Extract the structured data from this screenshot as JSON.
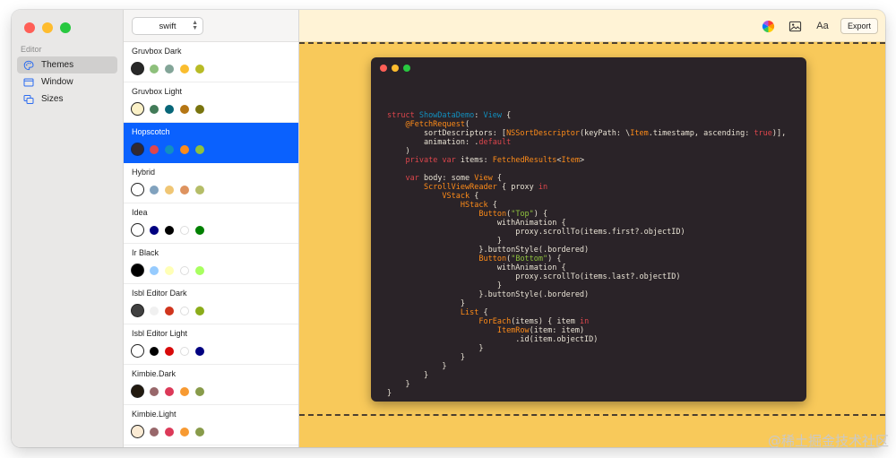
{
  "sidebar": {
    "header": "Editor",
    "items": [
      {
        "label": "Themes",
        "icon": "palette-icon",
        "active": true
      },
      {
        "label": "Window",
        "icon": "window-icon",
        "active": false
      },
      {
        "label": "Sizes",
        "icon": "sizes-icon",
        "active": false
      }
    ]
  },
  "language_select": {
    "value": "swift"
  },
  "themes": [
    {
      "name": "Gruvbox Dark",
      "background": "#282828",
      "colors": [
        "#8ec07c",
        "#83a598",
        "#fabd2f",
        "#b8bb26"
      ],
      "selected": false
    },
    {
      "name": "Gruvbox Light",
      "background": "#fbf1c7",
      "colors": [
        "#427b58",
        "#076678",
        "#b57614",
        "#79740e"
      ],
      "selected": false
    },
    {
      "name": "Hopscotch",
      "background": "#322931",
      "colors": [
        "#dd464c",
        "#1290bf",
        "#fd8b19",
        "#8fc13e"
      ],
      "selected": true
    },
    {
      "name": "Hybrid",
      "background": "#ffffff",
      "colors": [
        "#81a2be",
        "#f0c674",
        "#de935f",
        "#b5bd68"
      ],
      "selected": false
    },
    {
      "name": "Idea",
      "background": "#ffffff",
      "colors": [
        "#000080",
        "#000000",
        "#ffffff",
        "#008000"
      ],
      "selected": false
    },
    {
      "name": "Ir Black",
      "background": "#000000",
      "colors": [
        "#96cbfe",
        "#ffffb6",
        "#ffffff",
        "#a8ff60"
      ],
      "selected": false
    },
    {
      "name": "Isbl Editor Dark",
      "background": "#404040",
      "colors": [
        "#f0f0f0",
        "#d0351d",
        "#ffffff",
        "#8bac1a"
      ],
      "selected": false
    },
    {
      "name": "Isbl Editor Light",
      "background": "#ffffff",
      "colors": [
        "#000000",
        "#d80a0a",
        "#ffffff",
        "#000080"
      ],
      "selected": false
    },
    {
      "name": "Kimbie.Dark",
      "background": "#221a0f",
      "colors": [
        "#98676a",
        "#dc3958",
        "#f79a32",
        "#889b4a"
      ],
      "selected": false
    },
    {
      "name": "Kimbie.Light",
      "background": "#fbebd4",
      "colors": [
        "#98676a",
        "#dc3958",
        "#f79a32",
        "#889b4a"
      ],
      "selected": false
    }
  ],
  "toolbar": {
    "font_label": "Aa",
    "export_label": "Export"
  },
  "preview": {
    "background": "#f8c95a",
    "code_background": "#2a2328",
    "code_lines": [
      [],
      [],
      [
        {
          "t": "struct ",
          "c": "#dd464c"
        },
        {
          "t": "ShowDataDemo",
          "c": "#1290bf"
        },
        {
          "t": ": "
        },
        {
          "t": "View",
          "c": "#1290bf"
        },
        {
          "t": " {"
        }
      ],
      [
        {
          "t": "    @FetchRequest",
          "c": "#fd8b19"
        },
        {
          "t": "("
        }
      ],
      [
        {
          "t": "        sortDescriptors: ["
        },
        {
          "t": "NSSortDescriptor",
          "c": "#fd8b19"
        },
        {
          "t": "(keyPath: \\"
        },
        {
          "t": "Item",
          "c": "#fd8b19"
        },
        {
          "t": ".timestamp, ascending: "
        },
        {
          "t": "true",
          "c": "#dd464c"
        },
        {
          "t": ")],"
        }
      ],
      [
        {
          "t": "        animation: ."
        },
        {
          "t": "default",
          "c": "#dd464c"
        }
      ],
      [
        {
          "t": "    )"
        }
      ],
      [
        {
          "t": "    "
        },
        {
          "t": "private var",
          "c": "#dd464c"
        },
        {
          "t": " items: "
        },
        {
          "t": "FetchedResults",
          "c": "#fd8b19"
        },
        {
          "t": "<"
        },
        {
          "t": "Item",
          "c": "#fd8b19"
        },
        {
          "t": ">"
        }
      ],
      [],
      [
        {
          "t": "    "
        },
        {
          "t": "var",
          "c": "#dd464c"
        },
        {
          "t": " body: some "
        },
        {
          "t": "View",
          "c": "#fd8b19"
        },
        {
          "t": " {"
        }
      ],
      [
        {
          "t": "        "
        },
        {
          "t": "ScrollViewReader",
          "c": "#fd8b19"
        },
        {
          "t": " { proxy "
        },
        {
          "t": "in",
          "c": "#dd464c"
        }
      ],
      [
        {
          "t": "            "
        },
        {
          "t": "VStack",
          "c": "#fd8b19"
        },
        {
          "t": " {"
        }
      ],
      [
        {
          "t": "                "
        },
        {
          "t": "HStack",
          "c": "#fd8b19"
        },
        {
          "t": " {"
        }
      ],
      [
        {
          "t": "                    "
        },
        {
          "t": "Button",
          "c": "#fd8b19"
        },
        {
          "t": "("
        },
        {
          "t": "\"Top\"",
          "c": "#8fc13e"
        },
        {
          "t": ") {"
        }
      ],
      [
        {
          "t": "                        withAnimation {"
        }
      ],
      [
        {
          "t": "                            proxy.scrollTo(items.first?.objectID)"
        }
      ],
      [
        {
          "t": "                        }"
        }
      ],
      [
        {
          "t": "                    }.buttonStyle(.bordered)"
        }
      ],
      [
        {
          "t": "                    "
        },
        {
          "t": "Button",
          "c": "#fd8b19"
        },
        {
          "t": "("
        },
        {
          "t": "\"Bottom\"",
          "c": "#8fc13e"
        },
        {
          "t": ") {"
        }
      ],
      [
        {
          "t": "                        withAnimation {"
        }
      ],
      [
        {
          "t": "                            proxy.scrollTo(items.last?.objectID)"
        }
      ],
      [
        {
          "t": "                        }"
        }
      ],
      [
        {
          "t": "                    }.buttonStyle(.bordered)"
        }
      ],
      [
        {
          "t": "                }"
        }
      ],
      [
        {
          "t": "                "
        },
        {
          "t": "List",
          "c": "#fd8b19"
        },
        {
          "t": " {"
        }
      ],
      [
        {
          "t": "                    "
        },
        {
          "t": "ForEach",
          "c": "#fd8b19"
        },
        {
          "t": "(items) { item "
        },
        {
          "t": "in",
          "c": "#dd464c"
        }
      ],
      [
        {
          "t": "                        "
        },
        {
          "t": "ItemRow",
          "c": "#fd8b19"
        },
        {
          "t": "(item: item)"
        }
      ],
      [
        {
          "t": "                            .id(item.objectID)"
        }
      ],
      [
        {
          "t": "                    }"
        }
      ],
      [
        {
          "t": "                }"
        }
      ],
      [
        {
          "t": "            }"
        }
      ],
      [
        {
          "t": "        }"
        }
      ],
      [
        {
          "t": "    }"
        }
      ],
      [
        {
          "t": "}"
        }
      ]
    ]
  },
  "watermark": "@稀土掘金技术社区"
}
